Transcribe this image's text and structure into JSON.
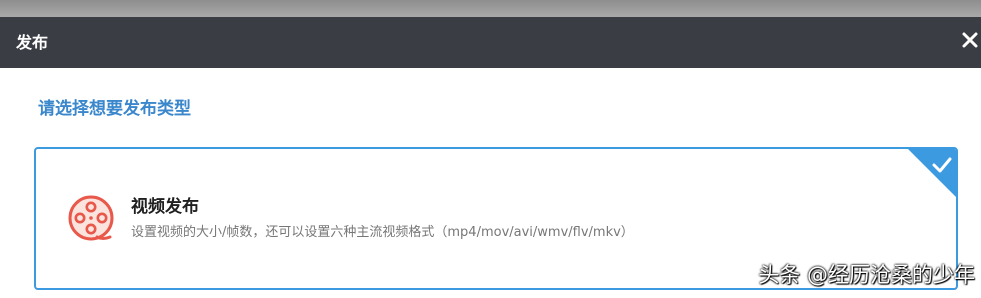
{
  "dialog": {
    "title": "发布",
    "close_icon": "close-icon"
  },
  "prompt": "请选择想要发布类型",
  "options": [
    {
      "title": "视频发布",
      "description": "设置视频的大小/帧数，还可以设置六种主流视频格式（mp4/mov/avi/wmv/flv/mkv）",
      "icon": "film-reel-icon",
      "selected": true
    }
  ],
  "watermark": "头条 @经历沧桑的少年",
  "colors": {
    "header_bg": "#3a3e44",
    "accent": "#3c9ae0",
    "prompt_text": "#3a87cc",
    "icon": "#e8584b"
  }
}
